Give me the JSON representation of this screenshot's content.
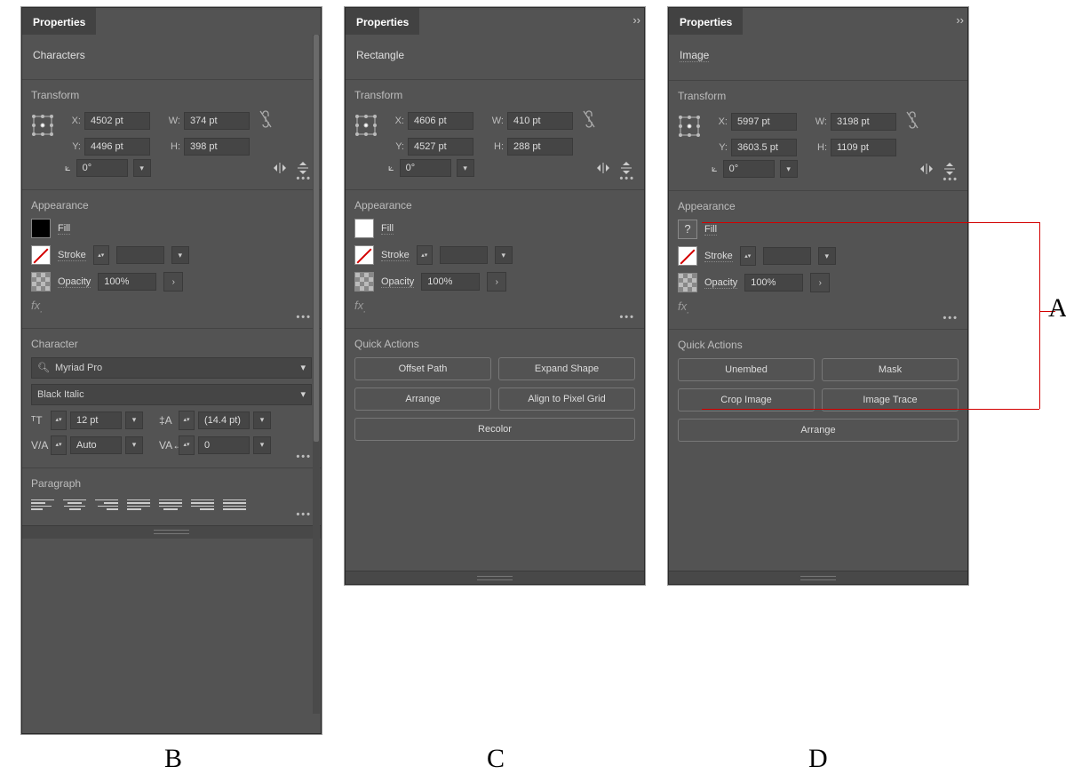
{
  "labels": {
    "properties": "Properties",
    "transform": "Transform",
    "appearance": "Appearance",
    "character": "Character",
    "paragraph": "Paragraph",
    "quick_actions": "Quick Actions",
    "fill": "Fill",
    "stroke": "Stroke",
    "opacity": "Opacity",
    "x": "X:",
    "y": "Y:",
    "w": "W:",
    "h": "H:"
  },
  "annotations": {
    "A": "A",
    "B": "B",
    "C": "C",
    "D": "D"
  },
  "panelB": {
    "selection": "Characters",
    "transform": {
      "x": "4502 pt",
      "y": "4496 pt",
      "w": "374 pt",
      "h": "398 pt",
      "angle": "0°"
    },
    "appearance": {
      "fill": "black",
      "opacity": "100%"
    },
    "character": {
      "font": "Myriad Pro",
      "style": "Black Italic",
      "size": "12 pt",
      "leading": "(14.4 pt)",
      "kerning": "Auto",
      "tracking": "0"
    }
  },
  "panelC": {
    "selection": "Rectangle",
    "transform": {
      "x": "4606 pt",
      "y": "4527 pt",
      "w": "410 pt",
      "h": "288 pt",
      "angle": "0°"
    },
    "appearance": {
      "fill": "white",
      "opacity": "100%"
    },
    "quick_actions": [
      "Offset Path",
      "Expand Shape",
      "Arrange",
      "Align to Pixel Grid",
      "Recolor"
    ]
  },
  "panelD": {
    "selection": "Image",
    "transform": {
      "x": "5997 pt",
      "y": "3603.5 pt",
      "w": "3198 pt",
      "h": "1109 pt",
      "angle": "0°"
    },
    "appearance": {
      "fill": "unknown",
      "opacity": "100%"
    },
    "quick_actions": [
      "Unembed",
      "Mask",
      "Crop Image",
      "Image Trace",
      "Arrange"
    ]
  }
}
